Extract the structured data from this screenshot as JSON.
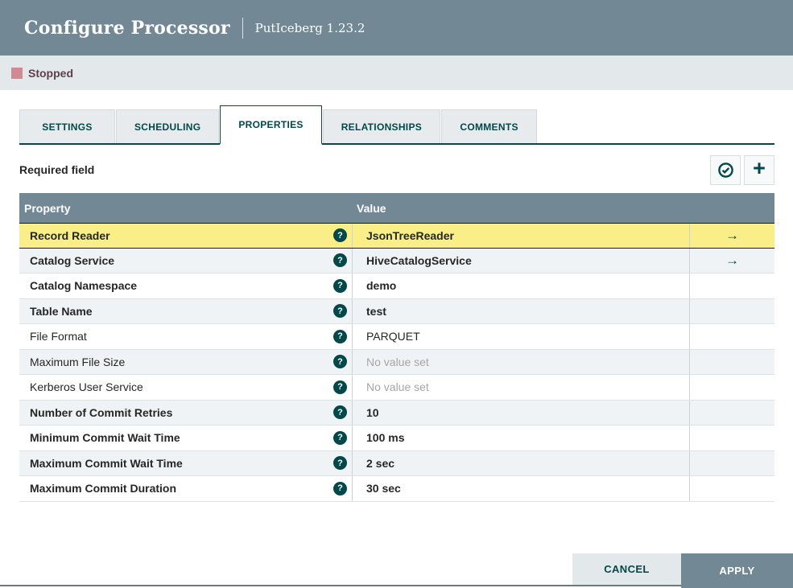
{
  "dialog": {
    "title": "Configure Processor",
    "subtitle": "PutIceberg 1.23.2",
    "status": "Stopped"
  },
  "tabs": [
    {
      "label": "SETTINGS",
      "active": false
    },
    {
      "label": "SCHEDULING",
      "active": false
    },
    {
      "label": "PROPERTIES",
      "active": true
    },
    {
      "label": "RELATIONSHIPS",
      "active": false
    },
    {
      "label": "COMMENTS",
      "active": false
    }
  ],
  "properties_panel": {
    "required_field_label": "Required field",
    "add_glyph": "+",
    "help_glyph": "?",
    "goto_glyph": "→",
    "table": {
      "columns": [
        "Property",
        "Value",
        ""
      ],
      "rows": [
        {
          "property": "Record Reader",
          "value": "JsonTreeReader",
          "required": true,
          "selected": true,
          "has_link": true,
          "empty": false
        },
        {
          "property": "Catalog Service",
          "value": "HiveCatalogService",
          "required": true,
          "selected": false,
          "has_link": true,
          "empty": false
        },
        {
          "property": "Catalog Namespace",
          "value": "demo",
          "required": true,
          "selected": false,
          "has_link": false,
          "empty": false
        },
        {
          "property": "Table Name",
          "value": "test",
          "required": true,
          "selected": false,
          "has_link": false,
          "empty": false
        },
        {
          "property": "File Format",
          "value": "PARQUET",
          "required": false,
          "selected": false,
          "has_link": false,
          "empty": false
        },
        {
          "property": "Maximum File Size",
          "value": "No value set",
          "required": false,
          "selected": false,
          "has_link": false,
          "empty": true
        },
        {
          "property": "Kerberos User Service",
          "value": "No value set",
          "required": false,
          "selected": false,
          "has_link": false,
          "empty": true
        },
        {
          "property": "Number of Commit Retries",
          "value": "10",
          "required": true,
          "selected": false,
          "has_link": false,
          "empty": false
        },
        {
          "property": "Minimum Commit Wait Time",
          "value": "100 ms",
          "required": true,
          "selected": false,
          "has_link": false,
          "empty": false
        },
        {
          "property": "Maximum Commit Wait Time",
          "value": "2 sec",
          "required": true,
          "selected": false,
          "has_link": false,
          "empty": false
        },
        {
          "property": "Maximum Commit Duration",
          "value": "30 sec",
          "required": true,
          "selected": false,
          "has_link": false,
          "empty": false
        }
      ]
    }
  },
  "footer": {
    "cancel_label": "CANCEL",
    "apply_label": "APPLY"
  },
  "colors": {
    "accent_teal": "#004849",
    "slate": "#728995",
    "selected_row": "#F9EE87",
    "stopped_red": "#D08A91",
    "status_bar_bg": "#E3E8EB"
  }
}
